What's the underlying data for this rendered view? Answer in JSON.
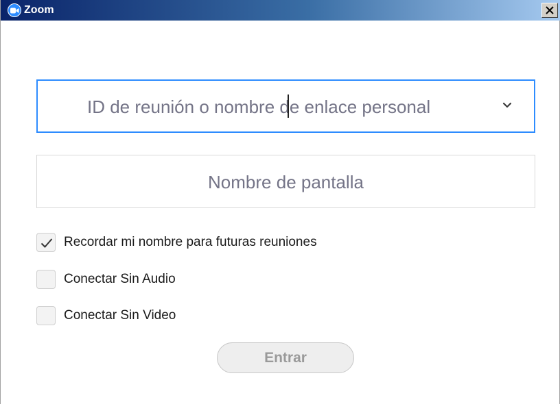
{
  "window": {
    "title": "Zoom",
    "app_icon": "zoom-camera-icon",
    "close_icon": "close-icon"
  },
  "form": {
    "meeting_id_placeholder": "ID de reunión o nombre de enlace personal",
    "meeting_id_value": "",
    "dropdown_icon": "chevron-down-icon",
    "display_name_placeholder": "Nombre de pantalla",
    "display_name_value": ""
  },
  "options": [
    {
      "label": "Recordar mi nombre para futuras reuniones",
      "checked": true
    },
    {
      "label": "Conectar Sin Audio",
      "checked": false
    },
    {
      "label": "Conectar Sin Video",
      "checked": false
    }
  ],
  "actions": {
    "join_label": "Entrar",
    "join_enabled": false
  },
  "colors": {
    "accent": "#2d8cff",
    "placeholder": "#747487",
    "disabled_text": "#9a9a9a"
  }
}
